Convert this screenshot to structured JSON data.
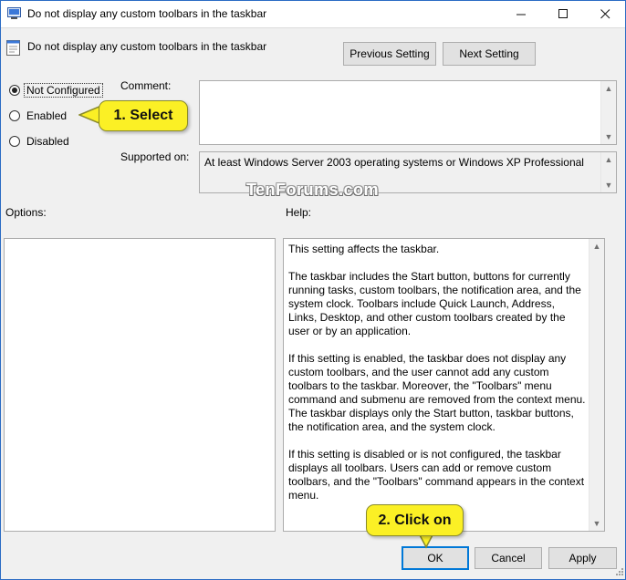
{
  "window": {
    "title": "Do not display any custom toolbars in the taskbar",
    "icons": {
      "app": "policy-window-icon",
      "minimize": "minimize-icon",
      "maximize": "maximize-icon",
      "close": "close-icon"
    }
  },
  "header": {
    "title": "Do not display any custom toolbars in the taskbar",
    "icon": "setting-page-icon",
    "previous_label": "Previous Setting",
    "next_label": "Next Setting"
  },
  "state": {
    "options": [
      {
        "label": "Not Configured",
        "selected": true
      },
      {
        "label": "Enabled",
        "selected": false
      },
      {
        "label": "Disabled",
        "selected": false
      }
    ]
  },
  "comment": {
    "label": "Comment:",
    "value": ""
  },
  "supported": {
    "label": "Supported on:",
    "value": "At least Windows Server 2003 operating systems or Windows XP Professional"
  },
  "watermark": "TenForums.com",
  "options_label": "Options:",
  "help": {
    "label": "Help:",
    "paragraphs": [
      "This setting affects the taskbar.",
      "The taskbar includes the Start button, buttons for currently running tasks, custom toolbars, the notification area, and the system clock. Toolbars include Quick Launch, Address, Links, Desktop, and other custom toolbars created by the user or by an application.",
      "If this setting is enabled, the taskbar does not display any custom toolbars, and the user cannot add any custom toolbars to the taskbar. Moreover, the \"Toolbars\" menu command and submenu are removed from the context menu. The taskbar displays only the Start button, taskbar buttons, the notification area, and the system clock.",
      "If this setting is disabled or is not configured, the taskbar displays all toolbars. Users can add or remove custom toolbars, and the \"Toolbars\" command appears in the context menu."
    ]
  },
  "footer": {
    "ok_label": "OK",
    "cancel_label": "Cancel",
    "apply_label": "Apply"
  },
  "callouts": {
    "select": "1. Select",
    "click": "2. Click on"
  },
  "colors": {
    "accent": "#0078d7",
    "callout": "#fbf025"
  }
}
